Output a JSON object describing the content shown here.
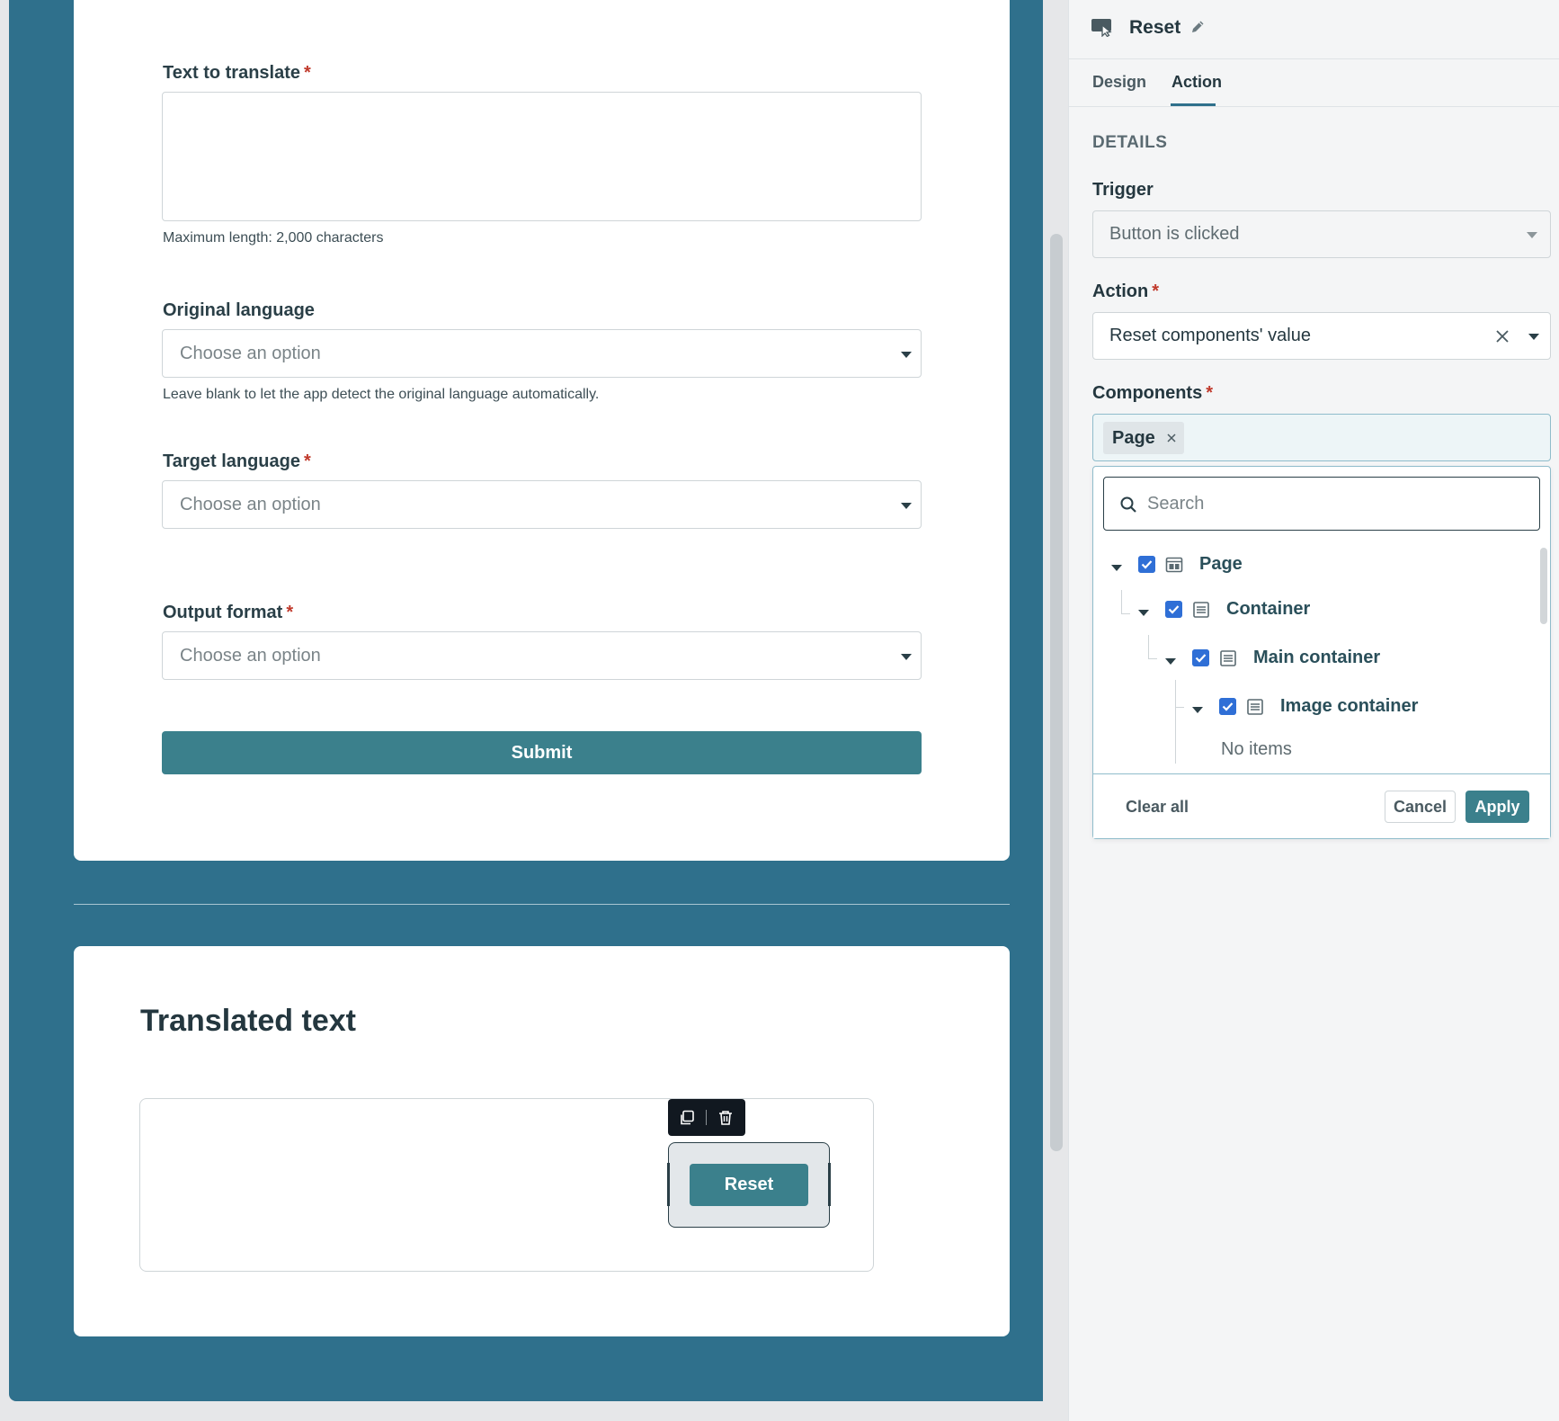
{
  "form": {
    "text_label": "Text to translate",
    "text_required": "*",
    "text_hint": "Maximum length: 2,000 characters",
    "original_label": "Original language",
    "original_placeholder": "Choose an option",
    "original_hint": "Leave blank to let the app detect the original language automatically.",
    "target_label": "Target language",
    "target_required": "*",
    "target_placeholder": "Choose an option",
    "output_label": "Output format",
    "output_required": "*",
    "output_placeholder": "Choose an option",
    "submit_label": "Submit"
  },
  "result": {
    "title": "Translated text",
    "reset_label": "Reset"
  },
  "panel": {
    "title": "Reset",
    "tabs": [
      {
        "label": "Design"
      },
      {
        "label": "Action"
      }
    ],
    "active_tab": "Action",
    "details_heading": "DETAILS",
    "trigger_label": "Trigger",
    "trigger_value": "Button is clicked",
    "action_label": "Action",
    "action_required": "*",
    "action_value": "Reset components' value",
    "components_label": "Components",
    "components_required": "*",
    "selected_chip": "Page",
    "search_placeholder": "Search",
    "tree": [
      {
        "label": "Page",
        "checked": true,
        "level": 0
      },
      {
        "label": "Container",
        "checked": true,
        "level": 1
      },
      {
        "label": "Main container",
        "checked": true,
        "level": 2
      },
      {
        "label": "Image container",
        "checked": true,
        "level": 3
      }
    ],
    "no_items": "No items",
    "clear_all": "Clear all",
    "cancel": "Cancel",
    "apply": "Apply"
  },
  "colors": {
    "canvas_bg": "#2f708c",
    "primary_button": "#3b808c",
    "checkbox": "#2f6fd6",
    "required": "#c0392b"
  },
  "icons": [
    "duplicate-icon",
    "trash-icon",
    "button-component-icon",
    "pencil-icon",
    "clear-icon",
    "search-icon",
    "chevron-down-icon",
    "page-icon",
    "container-icon",
    "checkbox-checked-icon"
  ]
}
